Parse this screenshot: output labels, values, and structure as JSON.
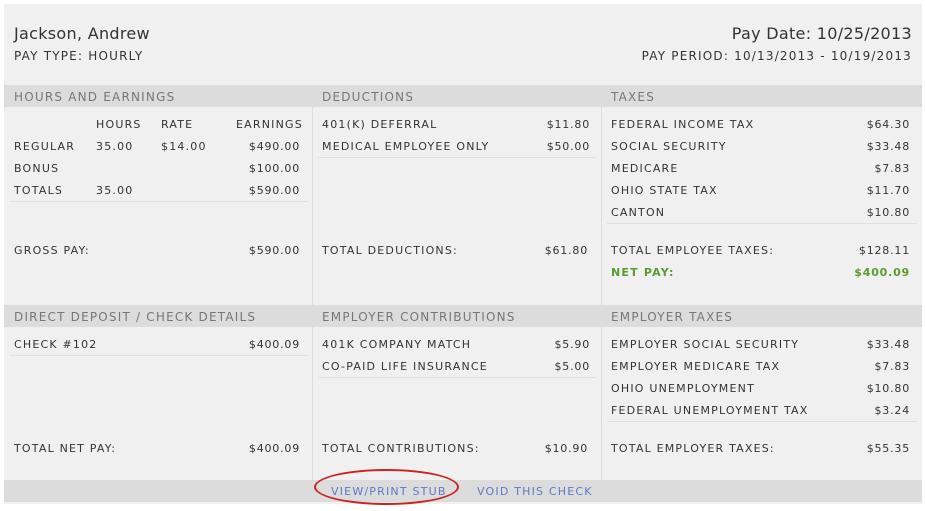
{
  "header": {
    "employee_name": "Jackson, Andrew",
    "pay_type": "PAY TYPE: HOURLY",
    "pay_date": "Pay Date: 10/25/2013",
    "pay_period": "PAY PERIOD: 10/13/2013 - 10/19/2013"
  },
  "hours_earnings": {
    "title": "HOURS AND EARNINGS",
    "col_hours": "HOURS",
    "col_rate": "RATE",
    "col_earnings": "EARNINGS",
    "rows": [
      {
        "label": "REGULAR",
        "hours": "35.00",
        "rate": "$14.00",
        "earnings": "$490.00"
      },
      {
        "label": "BONUS",
        "hours": "",
        "rate": "",
        "earnings": "$100.00"
      },
      {
        "label": "TOTALS",
        "hours": "35.00",
        "rate": "",
        "earnings": "$590.00"
      }
    ],
    "gross_label": "GROSS PAY:",
    "gross_value": "$590.00"
  },
  "deductions": {
    "title": "DEDUCTIONS",
    "rows": [
      {
        "label": "401(K) DEFERRAL",
        "value": "$11.80"
      },
      {
        "label": "MEDICAL EMPLOYEE ONLY",
        "value": "$50.00"
      }
    ],
    "total_label": "TOTAL DEDUCTIONS:",
    "total_value": "$61.80"
  },
  "taxes": {
    "title": "TAXES",
    "rows": [
      {
        "label": "FEDERAL INCOME TAX",
        "value": "$64.30"
      },
      {
        "label": "SOCIAL SECURITY",
        "value": "$33.48"
      },
      {
        "label": "MEDICARE",
        "value": "$7.83"
      },
      {
        "label": "OHIO STATE TAX",
        "value": "$11.70"
      },
      {
        "label": "CANTON",
        "value": "$10.80"
      }
    ],
    "total_label": "TOTAL EMPLOYEE TAXES:",
    "total_value": "$128.11",
    "net_label": "NET PAY:",
    "net_value": "$400.09"
  },
  "direct_deposit": {
    "title": "DIRECT DEPOSIT / CHECK DETAILS",
    "rows": [
      {
        "label": "CHECK #102",
        "value": "$400.09"
      }
    ],
    "total_label": "TOTAL NET PAY:",
    "total_value": "$400.09"
  },
  "employer_contributions": {
    "title": "EMPLOYER CONTRIBUTIONS",
    "rows": [
      {
        "label": "401K COMPANY MATCH",
        "value": "$5.90"
      },
      {
        "label": "CO-PAID LIFE INSURANCE",
        "value": "$5.00"
      }
    ],
    "total_label": "TOTAL CONTRIBUTIONS:",
    "total_value": "$10.90"
  },
  "employer_taxes": {
    "title": "EMPLOYER TAXES",
    "rows": [
      {
        "label": "EMPLOYER SOCIAL SECURITY",
        "value": "$33.48"
      },
      {
        "label": "EMPLOYER MEDICARE TAX",
        "value": "$7.83"
      },
      {
        "label": "OHIO UNEMPLOYMENT",
        "value": "$10.80"
      },
      {
        "label": "FEDERAL UNEMPLOYMENT TAX",
        "value": "$3.24"
      }
    ],
    "total_label": "TOTAL EMPLOYER TAXES:",
    "total_value": "$55.35"
  },
  "footer": {
    "view_print_label": "VIEW/PRINT STUB",
    "void_label": "VOID THIS CHECK"
  },
  "colors": {
    "net_pay_green": "#5a9a2e",
    "link_blue": "#5b7bc4",
    "annotation_red": "#cc2222"
  }
}
